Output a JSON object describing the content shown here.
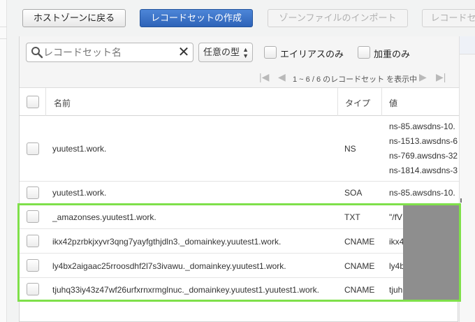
{
  "toolbar": {
    "back_label": "ホストゾーンに戻る",
    "create_label": "レコードセットの作成",
    "import_label": "ゾーンファイルのインポート",
    "recordset_partial_label": "レコードセ"
  },
  "filter": {
    "search_placeholder": "レコードセット名",
    "type_select": "任意の型",
    "alias_only": "エイリアスのみ",
    "weighted_only": "加重のみ"
  },
  "pager": {
    "text": "1 ~ 6 / 6 のレコードセット を表示中"
  },
  "table": {
    "headers": {
      "name": "名前",
      "type": "タイプ",
      "value": "値"
    },
    "rows": [
      {
        "name": "yuutest1.work.",
        "type": "NS",
        "values": [
          "ns-85.awsdns-10.",
          "ns-1513.awsdns-6",
          "ns-769.awsdns-32",
          "ns-1814.awsdns-3"
        ]
      },
      {
        "name": "yuutest1.work.",
        "type": "SOA",
        "values": [
          "ns-85.awsdns-10."
        ]
      },
      {
        "name": "_amazonses.yuutest1.work.",
        "type": "TXT",
        "values": [
          "\"/fV"
        ]
      },
      {
        "name": "ikx42pzrbkjxyvr3qng7yayfgthjdln3._domainkey.yuutest1.work.",
        "type": "CNAME",
        "values": [
          "ikx4"
        ]
      },
      {
        "name": "ly4bx2aigaac25rroosdhf2l7s3ivawu._domainkey.yuutest1.work.",
        "type": "CNAME",
        "values": [
          "ly4b"
        ]
      },
      {
        "name": "tjuhq33iy43z47wf26urfxrnxrmglnuc._domainkey.yuutest1.yuutest1.work.",
        "type": "CNAME",
        "values": [
          "tjuh"
        ]
      }
    ]
  },
  "colors": {
    "primary": "#2e63b8",
    "highlight": "#7fe04a",
    "redaction": "#8e8e8e"
  }
}
